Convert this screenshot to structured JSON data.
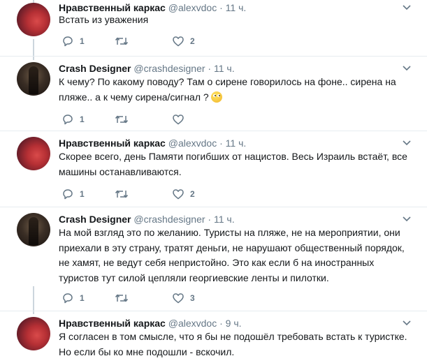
{
  "tweets": [
    {
      "name": "Нравственный каркас",
      "handle": "@alexvdoc",
      "time": "11 ч.",
      "text": "Встать из уважения",
      "replies": "1",
      "retweets": "",
      "likes": "2"
    },
    {
      "name": "Crash Designer",
      "handle": "@crashdesigner",
      "time": "11 ч.",
      "text": "К чему? По какому поводу? Там о сирене говорилось на фоне.. сирена на пляже.. а к чему сирена/сигнал ?",
      "replies": "1",
      "retweets": "",
      "likes": ""
    },
    {
      "name": "Нравственный каркас",
      "handle": "@alexvdoc",
      "time": "11 ч.",
      "text": "Скорее всего, день Памяти погибших от нацистов. Весь Израиль встаёт, все машины останавливаются.",
      "replies": "1",
      "retweets": "",
      "likes": "2"
    },
    {
      "name": "Crash Designer",
      "handle": "@crashdesigner",
      "time": "11 ч.",
      "text": "На мой взгляд это по желанию. Туристы на пляже, не на мероприятии, они приехали в эту страну, тратят деньги, не нарушают общественный порядок, не хамят, не ведут себя непристойно. Это как если б на иностранных туристов тут силой цепляли георгиевские ленты и пилотки.",
      "replies": "1",
      "retweets": "",
      "likes": "3"
    },
    {
      "name": "Нравственный каркас",
      "handle": "@alexvdoc",
      "time": "9 ч.",
      "text": "Я согласен в том смысле, что я бы не подошёл требовать встать к туристке. Но если бы ко мне подошли - вскочил.",
      "replies": "",
      "retweets": "",
      "likes": ""
    }
  ],
  "icons": {
    "reply": "reply-icon",
    "retweet": "retweet-icon",
    "like": "heart-icon",
    "more": "chevron-down-icon",
    "emoji": "rolling-eyes-emoji"
  },
  "colors": {
    "text": "#14171a",
    "secondary": "#657786",
    "thread_line": "#ccd6dd",
    "divider": "#e6ecf0"
  }
}
